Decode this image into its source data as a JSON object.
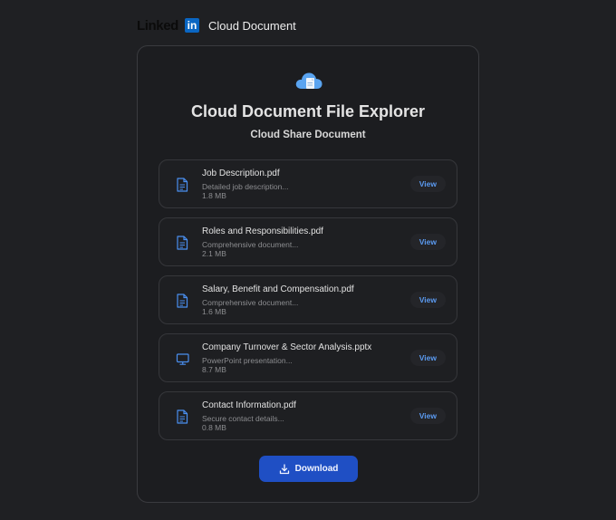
{
  "header": {
    "brand_word": "Linked",
    "brand_in": "in",
    "title": "Cloud Document"
  },
  "card": {
    "title": "Cloud Document File Explorer",
    "subtitle": "Cloud Share Document",
    "download_label": "Download"
  },
  "files": [
    {
      "name": "Job Description.pdf",
      "desc": "Detailed job description...",
      "size": "1.8 MB",
      "icon": "document-icon",
      "view": "View"
    },
    {
      "name": "Roles and Responsibilities.pdf",
      "desc": "Comprehensive document...",
      "size": "2.1 MB",
      "icon": "document-icon",
      "view": "View"
    },
    {
      "name": "Salary, Benefit and Compensation.pdf",
      "desc": "Comprehensive document...",
      "size": "1.6 MB",
      "icon": "document-icon",
      "view": "View"
    },
    {
      "name": "Company Turnover & Sector Analysis.pptx",
      "desc": "PowerPoint presentation...",
      "size": "8.7 MB",
      "icon": "monitor-icon",
      "view": "View"
    },
    {
      "name": "Contact Information.pdf",
      "desc": "Secure contact details...",
      "size": "0.8 MB",
      "icon": "document-icon",
      "view": "View"
    }
  ],
  "colors": {
    "accent": "#1f4fc4",
    "link": "#5b9bf2",
    "icon": "#4a8ff0",
    "background": "#1f2023"
  }
}
